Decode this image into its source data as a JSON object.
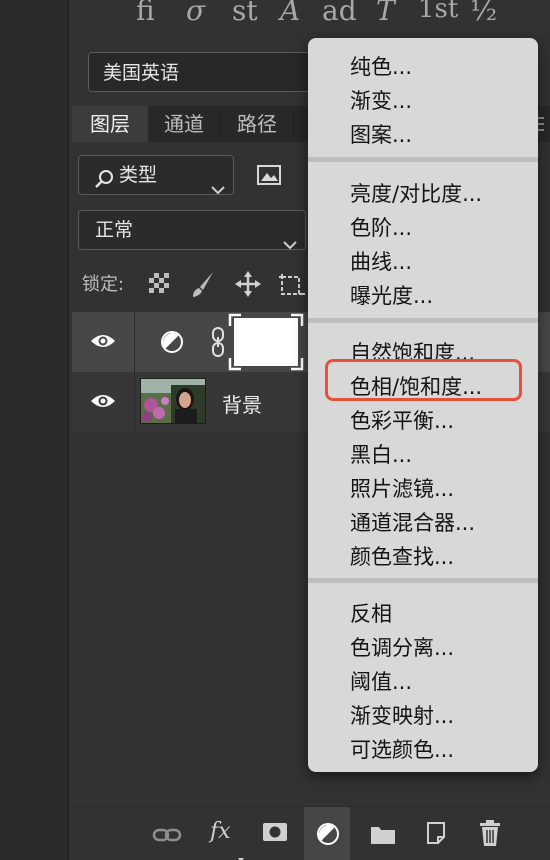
{
  "glyph_bar": {
    "ligatures": [
      "fi",
      "σ",
      "st",
      "A",
      "ad",
      "T",
      "1st",
      "½"
    ]
  },
  "language": {
    "value": "美国英语"
  },
  "tabs": [
    {
      "label": "图层",
      "active": true
    },
    {
      "label": "通道",
      "active": false
    },
    {
      "label": "路径",
      "active": false
    }
  ],
  "filter": {
    "label": "类型"
  },
  "blend_mode": {
    "value": "正常"
  },
  "lock": {
    "label": "锁定:"
  },
  "layers": [
    {
      "name": "",
      "type": "adjustment",
      "selected": true
    },
    {
      "name": "背景",
      "type": "image",
      "selected": false
    }
  ],
  "menu": {
    "groups": [
      [
        "纯色...",
        "渐变...",
        "图案..."
      ],
      [
        "亮度/对比度...",
        "色阶...",
        "曲线...",
        "曝光度..."
      ],
      [
        "自然饱和度...",
        "色相/饱和度...",
        "色彩平衡...",
        "黑白...",
        "照片滤镜...",
        "通道混合器...",
        "颜色查找..."
      ],
      [
        "反相",
        "色调分离...",
        "阈值...",
        "渐变映射...",
        "可选颜色..."
      ]
    ],
    "highlighted": "色相/饱和度...",
    "highlight_color": "#e8503a"
  },
  "bottom_bar": {
    "fx_label": "fx"
  }
}
